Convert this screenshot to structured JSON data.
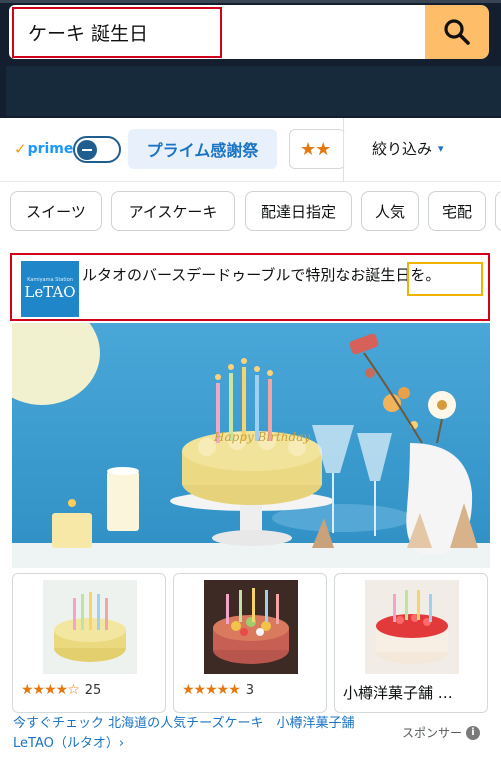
{
  "search": {
    "query": "ケーキ 誕生日"
  },
  "filters": {
    "prime_label": "prime",
    "prime_check": "✓",
    "prime_sale": "プライム感謝祭",
    "stars_chip": "★★",
    "refine_label": "絞り込み",
    "refine_chevron": "▾"
  },
  "categories": [
    "スイーツ",
    "アイスケーキ",
    "配達日指定",
    "人気",
    "宅配"
  ],
  "ad": {
    "brand_logo_top": "Kamiyama Station",
    "brand_logo_text": "LeTAO",
    "headline": "ルタオのバースデードゥーブルで特別なお誕生日を。",
    "hero_topper_text": "Happy Birthday",
    "products": [
      {
        "rating_stars": "★★★★☆",
        "rating_count": "25"
      },
      {
        "rating_stars": "★★★★★",
        "rating_count": "3"
      },
      {
        "name": "小樽洋菓子舗 …"
      }
    ],
    "link_text": "今すぐチェック 北海道の人気チーズケーキ　小樽洋菓子舗LeTAO（ルタオ）›",
    "sponsored_label": "スポンサー",
    "info_icon_glyph": "i"
  },
  "colors": {
    "header_bg": "#131f2e",
    "search_button": "#febd69",
    "annotation_red": "#d0021b",
    "annotation_yellow": "#f0b400",
    "link_blue": "#1a73c4",
    "star_orange": "#e47911"
  }
}
